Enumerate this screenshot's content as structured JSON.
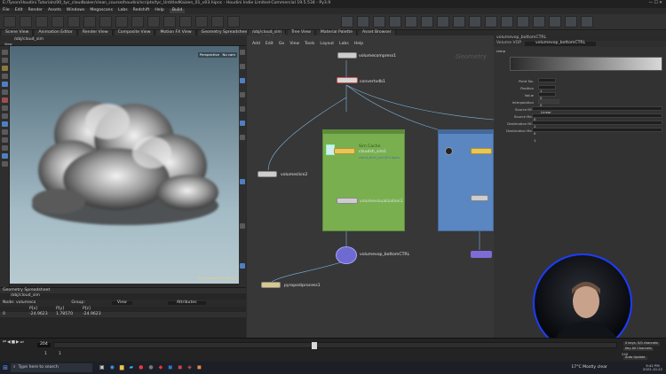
{
  "window": {
    "title": "E:/Tyson/Houdini Tutorials/00_tyc_cloudbaker/clean_course/houdini/scripts/tyc_UntitledKaizen_01_v03.hipnc - Houdini Indie Limited-Commercial 19.5.534 - Py3.9"
  },
  "menu": [
    "File",
    "Edit",
    "Render",
    "Assets",
    "Windows",
    "Megascans",
    "Labs",
    "Redshift",
    "Help"
  ],
  "desktop_label": "Build",
  "viewport": {
    "tabs": [
      "Scene View",
      "Animation Editor",
      "Render View",
      "Composite View",
      "Motion FX View",
      "Geometry Spreadsheet"
    ],
    "path": "/obj/cloud_sim",
    "view_label": "View",
    "camera_label": "Perspective",
    "cam_label": "No cam",
    "status_text": "Non-Commercial Edition"
  },
  "spreadsheet": {
    "tab": "Geometry Spreadsheet",
    "path": "/obj/cloud_sim",
    "node_label": "Node: volumeco",
    "filter_label": "Group:",
    "view_label": "View",
    "attr_label": "Attributes",
    "headers": [
      "",
      "P[x]",
      "P[y]",
      "P[z]"
    ],
    "rows": [
      [
        "0",
        "-24.9623",
        "1.78570",
        "-24.9623"
      ]
    ]
  },
  "network": {
    "tabs": [
      "/obj/cloud_sim",
      "Tree View",
      "Material Palette",
      "Asset Browser"
    ],
    "path": "/obj/cloud_sim",
    "menu": [
      "Add",
      "Edit",
      "Go",
      "View",
      "Tools",
      "Layout",
      "Labs",
      "Help"
    ],
    "context_label": "Geometry",
    "nodes": {
      "volumecompress1": "volumecompress1",
      "convertvdb1": "convertvdb1",
      "volumeslice2": "volumeslice2",
      "sim_label": "Sim Cache",
      "simcache": "cloudsh_sim1",
      "simcache_sub": "cloud_sim1_out.$F4.bgeo",
      "volumevisualization1": "volumevisualization1",
      "volumevop_bottomCTRL": "volumevop_bottomCTRL",
      "pyropostprocess1": "pyropostprocess1"
    }
  },
  "params": {
    "header_type": "Volume VOP",
    "header_name": "volumevop_bottomCTRL",
    "tab": "volumevop_bottomCTRL",
    "ramp_label": "ramp",
    "fields": [
      {
        "label": "Point No.",
        "value": "1"
      },
      {
        "label": "Position",
        "value": "0"
      },
      {
        "label": "Value",
        "value": "0"
      },
      {
        "label": "Interpolation",
        "value": "Linear"
      },
      {
        "label": "Source Min",
        "value": "0"
      },
      {
        "label": "Source Max",
        "value": "1"
      },
      {
        "label": "Destination Min",
        "value": "0"
      },
      {
        "label": "Destination Max",
        "value": "1"
      }
    ]
  },
  "timeline": {
    "frame": "204",
    "start": "1",
    "end": "240",
    "keys_label": "0 keys, 0/0 channels",
    "key_all_label": "Key All Channels",
    "auto_update": "Auto Update"
  },
  "taskbar": {
    "search_placeholder": "Type here to search",
    "weather": "17°C  Mostly clear",
    "time": "9:42 PM",
    "date": "2022-10-22"
  }
}
